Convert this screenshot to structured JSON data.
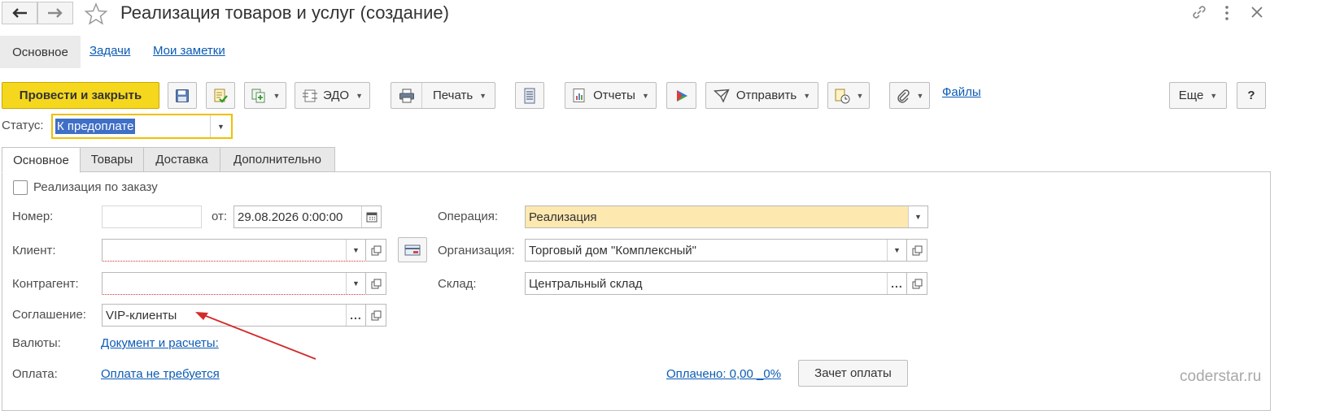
{
  "window": {
    "title": "Реализация товаров и услуг (создание)"
  },
  "top_tabs": {
    "main": "Основное",
    "tasks": "Задачи",
    "notes": "Мои заметки"
  },
  "toolbar": {
    "post_close": "Провести и закрыть",
    "edo": "ЭДО",
    "print": "Печать",
    "reports": "Отчеты",
    "send": "Отправить",
    "files": "Файлы",
    "more": "Еще",
    "help": "?"
  },
  "status": {
    "label": "Статус:",
    "value": "К предоплате"
  },
  "tabs": [
    "Основное",
    "Товары",
    "Доставка",
    "Дополнительно"
  ],
  "form": {
    "by_order_label": "Реализация по заказу",
    "number_label": "Номер:",
    "number_value": "",
    "date_label": "от:",
    "date_value": "29.08.2026  0:00:00",
    "client_label": "Клиент:",
    "client_value": "",
    "counterparty_label": "Контрагент:",
    "counterparty_value": "",
    "agreement_label": "Соглашение:",
    "agreement_value": "VIP-клиенты",
    "currency_label": "Валюты:",
    "currency_link": "Документ и расчеты:",
    "payment_label": "Оплата:",
    "payment_link": "Оплата не требуется",
    "operation_label": "Операция:",
    "operation_value": "Реализация",
    "organization_label": "Организация:",
    "organization_value": "Торговый дом \"Комплексный\"",
    "warehouse_label": "Склад:",
    "warehouse_value": "Центральный склад",
    "paid_link": "Оплачено: 0,00 _0%",
    "offset_button": "Зачет оплаты"
  },
  "watermark": "coderstar.ru",
  "colors": {
    "primary_button": "#f5d71e",
    "link": "#0b5bb5",
    "operation_bg": "#fde8b0",
    "status_border": "#f0c000",
    "status_selection": "#3f6fc6",
    "required_underline": "#d23434",
    "annotation_arrow": "#d42a2a"
  }
}
